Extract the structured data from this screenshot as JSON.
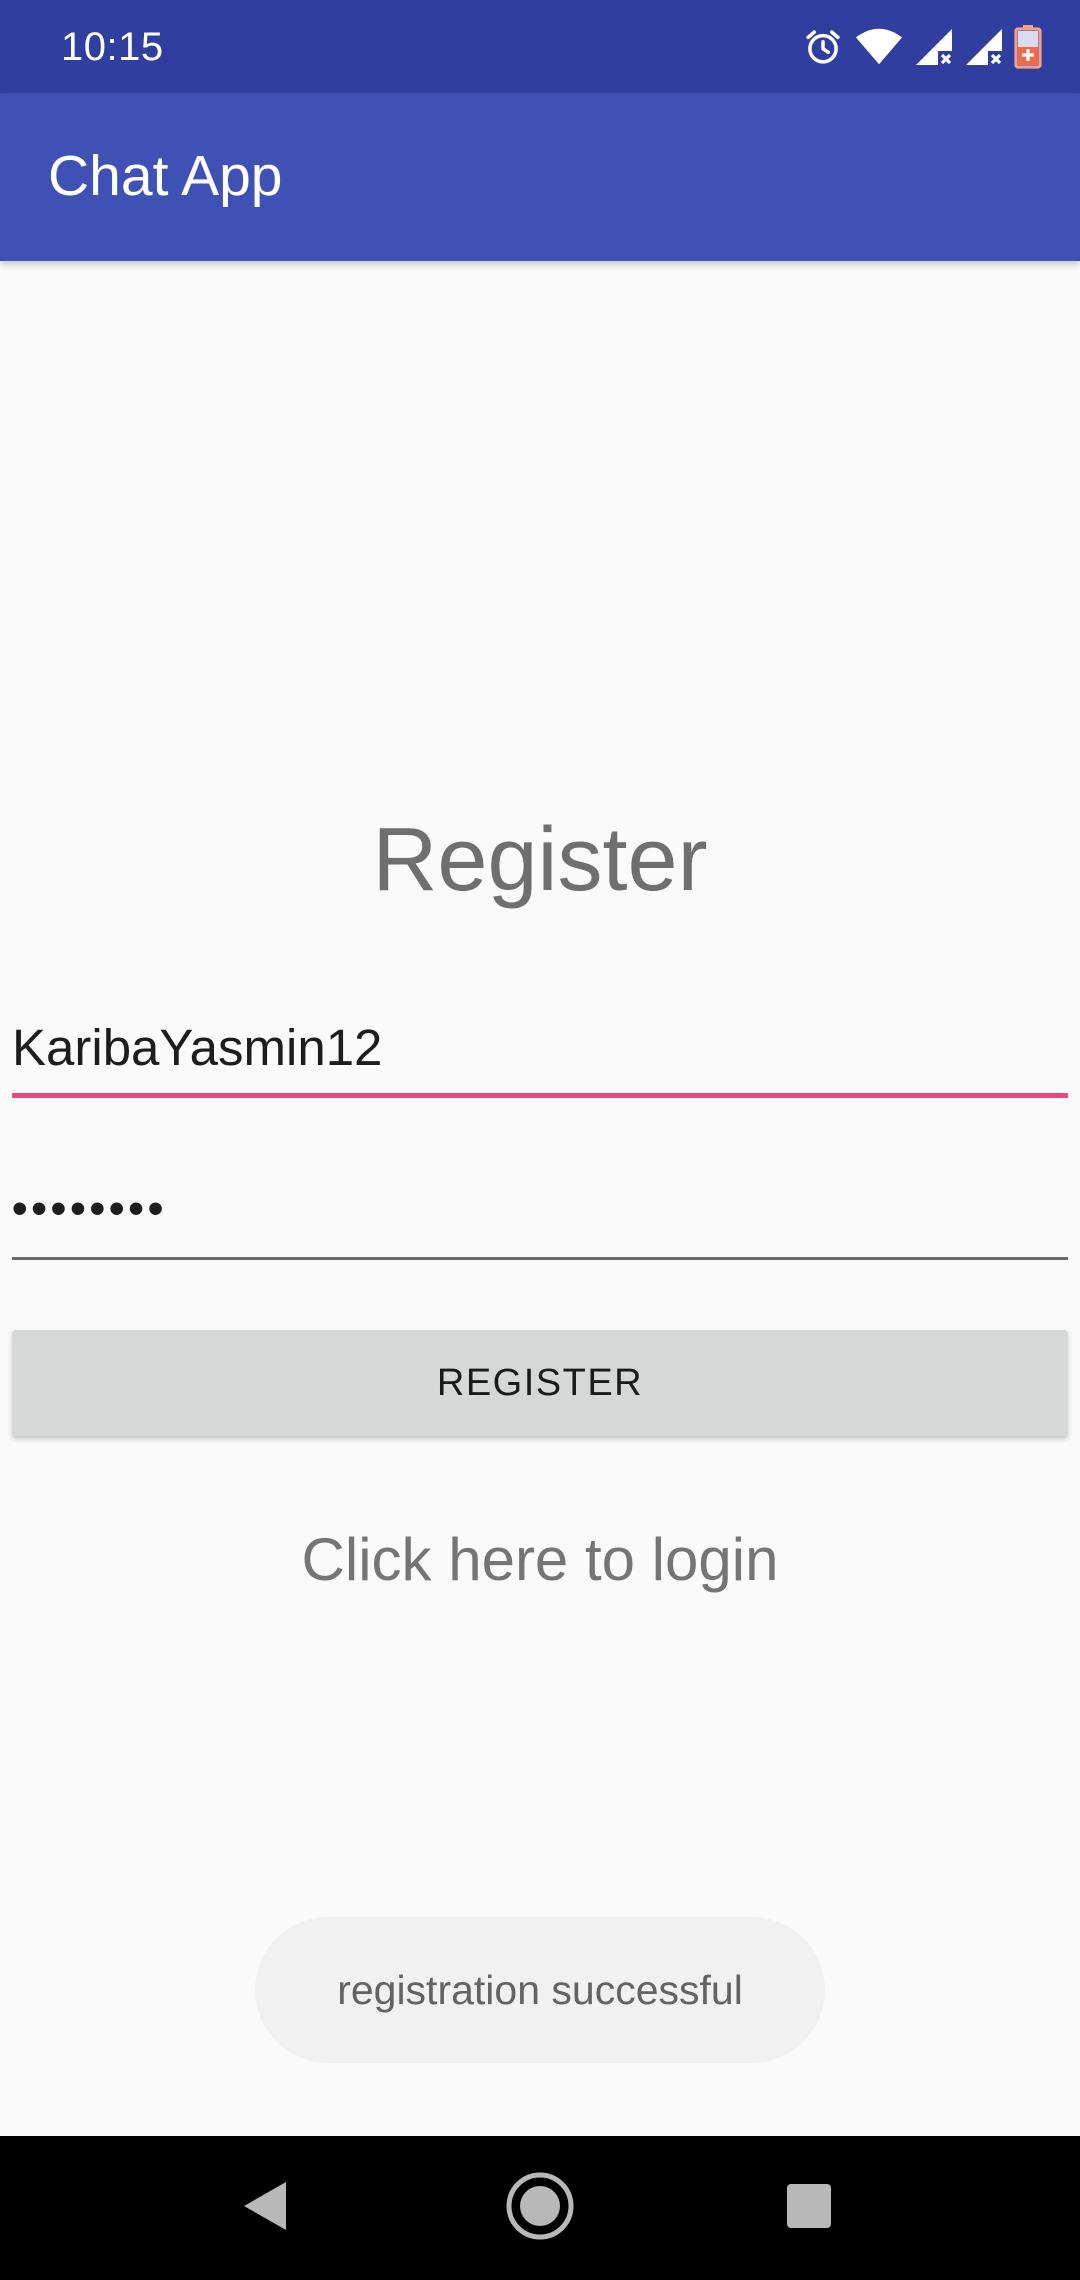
{
  "status_bar": {
    "time": "10:15",
    "icons": [
      "alarm-icon",
      "wifi-icon",
      "signal-no-data-icon",
      "signal-no-data-icon",
      "battery-charging-icon"
    ]
  },
  "app_bar": {
    "title": "Chat App"
  },
  "form": {
    "heading": "Register",
    "username_value": "KaribaYasmin12",
    "password_value": "12345678",
    "register_label": "REGISTER",
    "login_link": "Click here to login"
  },
  "toast": {
    "message": "registration successful"
  },
  "nav_bar": {
    "buttons": [
      "back-icon",
      "home-icon",
      "recents-icon"
    ]
  },
  "colors": {
    "status_bar": "#303f9f",
    "app_bar": "#3f51b5",
    "accent": "#e84a7f",
    "background": "#fafafa"
  }
}
